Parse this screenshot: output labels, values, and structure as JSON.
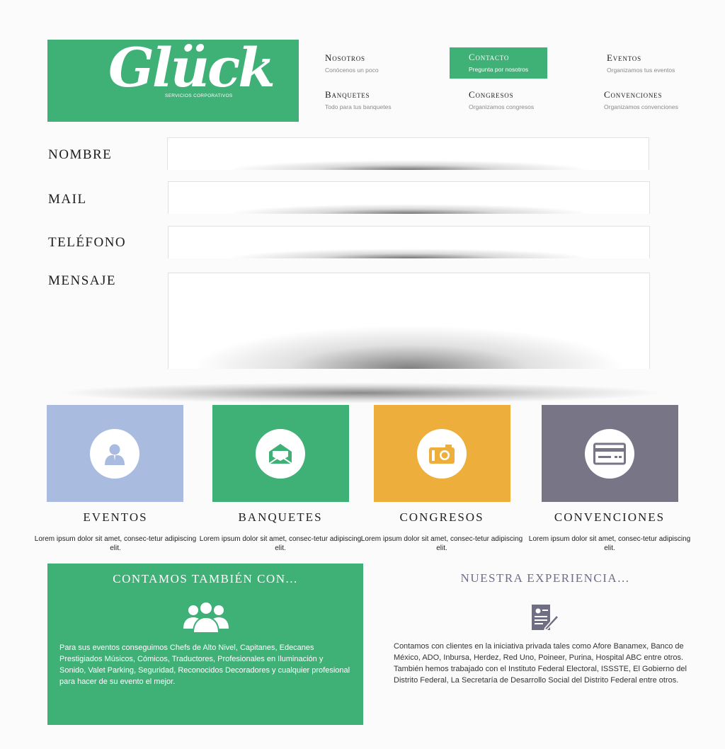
{
  "logo": {
    "name": "Glück",
    "tagline": "SERVICIOS CORPORATIVOS"
  },
  "nav": [
    {
      "title": "Nosotros",
      "subtitle": "Conócenos un poco"
    },
    {
      "title": "Contacto",
      "subtitle": "Pregunta por nosotros",
      "active": true
    },
    {
      "title": "Eventos",
      "subtitle": "Organizamos tus eventos"
    },
    {
      "title": "Banquetes",
      "subtitle": "Todo para tus banquetes"
    },
    {
      "title": "Congresos",
      "subtitle": "Organizamos congresos"
    },
    {
      "title": "Convenciones",
      "subtitle": "Organizamos convenciones"
    }
  ],
  "form": {
    "name_label": "NOMBRE",
    "mail_label": "MAIL",
    "phone_label": "TELÉFONO",
    "message_label": "MENSAJE",
    "name_value": "",
    "mail_value": "",
    "phone_value": "",
    "message_value": ""
  },
  "services": [
    {
      "title": "EVENTOS",
      "description": "Lorem ipsum dolor sit amet, consec-tetur adipiscing elit.",
      "color": "#a9bbdf",
      "icon": "person-icon"
    },
    {
      "title": "BANQUETES",
      "description": "Lorem ipsum dolor sit amet, consec-tetur adipiscing elit.",
      "color": "#3fb076",
      "icon": "envelope-icon"
    },
    {
      "title": "CONGRESOS",
      "description": "Lorem ipsum dolor sit amet, consec-tetur adipiscing elit.",
      "color": "#eeae3c",
      "icon": "camera-icon"
    },
    {
      "title": "CONVENCIONES",
      "description": "Lorem ipsum dolor sit amet, consec-tetur adipiscing elit.",
      "color": "#777586",
      "icon": "credit-card-icon"
    }
  ],
  "contamos": {
    "title": "CONTAMOS TAMBIÉN CON...",
    "icon": "group-icon",
    "text": "Para sus eventos conseguimos Chefs de Alto Nivel, Capitanes, Edecanes Prestigiados Músicos, Cómicos, Traductores, Profesionales en Iluminación y Sonido, Valet Parking, Seguridad, Reconocidos Decoradores y cualquier profesional para hacer de su evento el mejor."
  },
  "experiencia": {
    "title": "NUESTRA EXPERIENCIA...",
    "icon": "document-pen-icon",
    "text": "Contamos con clientes en la iniciativa privada tales como Afore Banamex, Banco de México, ADO, Inbursa, Herdez, Red Uno, Poineer, Purina, Hospital ABC entre otros. También hemos trabajado con el Instituto Federal Electoral, ISSSTE, El Gobierno del Distrito Federal, La Secretaría de Desarrollo Social del Distrito Federal entre otros."
  }
}
